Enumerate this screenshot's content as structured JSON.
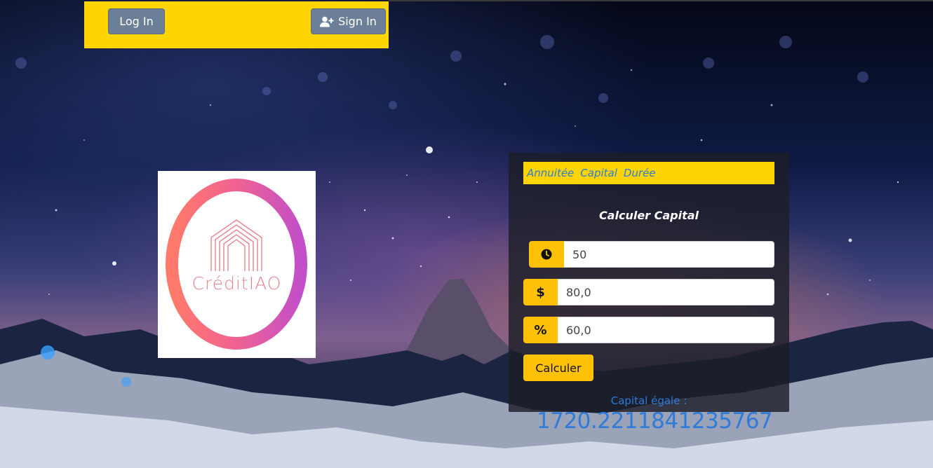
{
  "nav": {
    "login_label": "Log In",
    "signin_label": "Sign In",
    "signin_icon": "user-plus-icon"
  },
  "logo": {
    "text": "CréditIAO",
    "icon": "house-arches-logo"
  },
  "calculator": {
    "tabs": [
      {
        "label": "Annuitée"
      },
      {
        "label": "Capital"
      },
      {
        "label": "Durée"
      }
    ],
    "title": "Calculer Capital",
    "fields": [
      {
        "icon": "clock-icon",
        "value": "50"
      },
      {
        "icon": "dollar-icon",
        "addon": "$",
        "value": "80,0"
      },
      {
        "icon": "percent-icon",
        "addon": "%",
        "value": "60,0"
      }
    ],
    "submit_label": "Calculer"
  },
  "result": {
    "label": "Capital égale :",
    "value": "1720.2211841235767"
  },
  "colors": {
    "accent_yellow": "#ffd500",
    "button_yellow": "#ffc107",
    "nav_button": "#6c7f99",
    "link_blue": "#2f7bd8",
    "panel_bg": "#1c1e28"
  }
}
